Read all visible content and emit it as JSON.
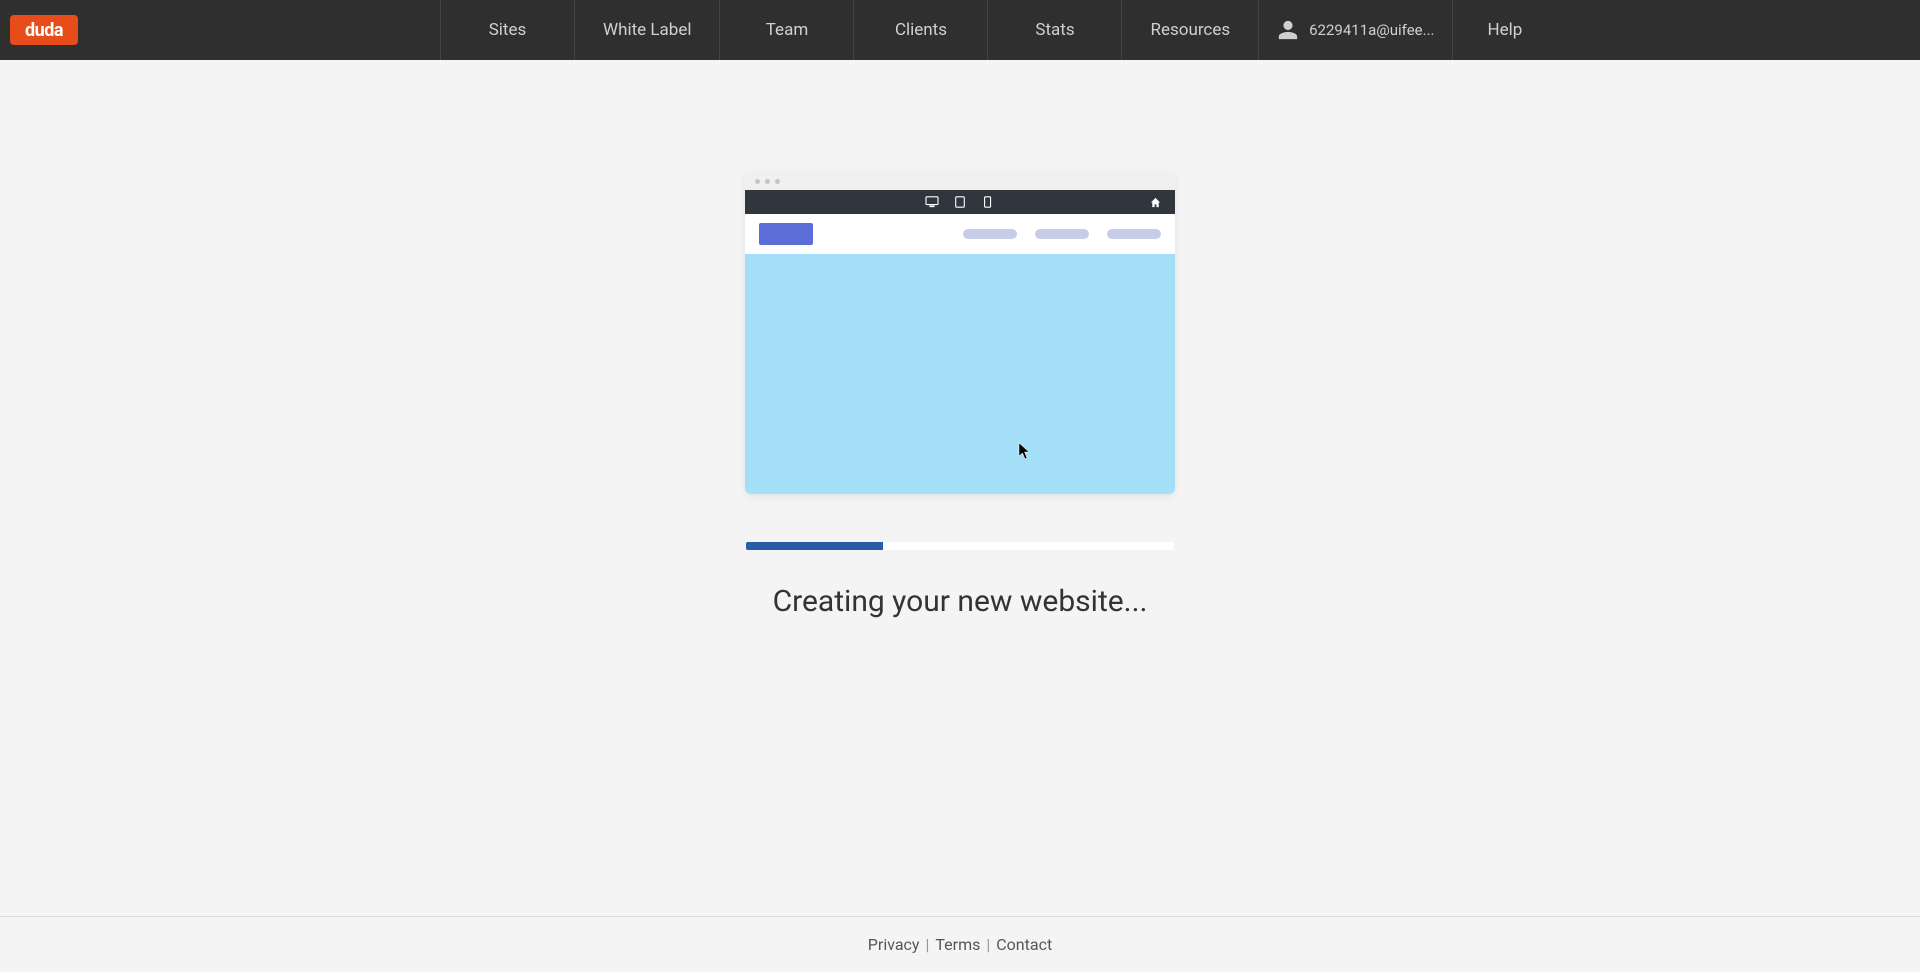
{
  "logo_text": "duda",
  "nav": {
    "sites": "Sites",
    "white_label": "White Label",
    "team": "Team",
    "clients": "Clients",
    "stats": "Stats",
    "resources": "Resources"
  },
  "user": {
    "email": "6229411a@uifee..."
  },
  "help_label": "Help",
  "loading": {
    "status_text": "Creating your new website...",
    "progress_percent": 32
  },
  "footer": {
    "privacy": "Privacy",
    "terms": "Terms",
    "contact": "Contact",
    "separator": "|"
  }
}
